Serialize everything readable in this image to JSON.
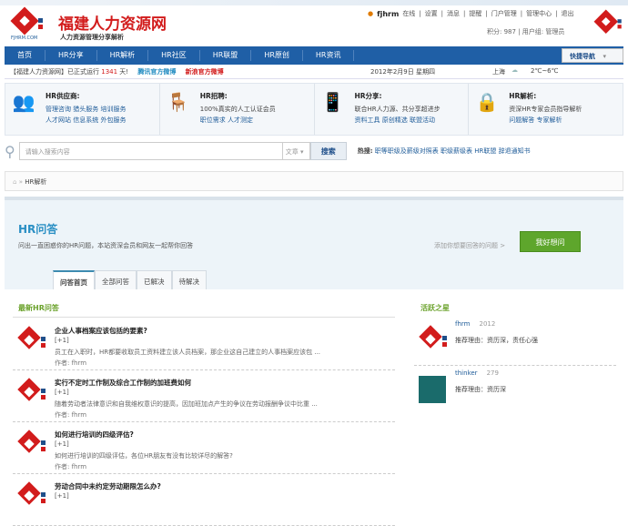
{
  "header": {
    "site_name": "福建人力资源网",
    "slogan": "人力资源管理分享解析",
    "logo_text": "FJHRM.COM",
    "user": "fjhrm",
    "links": [
      "在线",
      "设置",
      "消息",
      "提醒",
      "门户管理",
      "管理中心",
      "退出"
    ],
    "credits": "积分: 987",
    "usergroup": "用户组: 管理员"
  },
  "nav": {
    "items": [
      "首页",
      "HR分享",
      "HR解析",
      "HR社区",
      "HR联盟",
      "HR原创",
      "HR资讯"
    ],
    "quick": "快捷导航"
  },
  "info": {
    "running_prefix": "【福建人力资源网】已正式运行",
    "days": "1341",
    "running_suffix": "天!",
    "tencent": "腾讯官方微博",
    "sina": "新浪官方微博",
    "date": "2012年2月9日 星期四",
    "city": "上海",
    "temp": "2℃~6℃"
  },
  "features": [
    {
      "title": "HR供应商:",
      "line1": "管理咨询 猎头服务 培训服务",
      "line2": "人才网站 信息系统 外包服务"
    },
    {
      "title": "HR招聘:",
      "line1": "100%真实的人工认证会员",
      "line2": "职位需求 人才测定"
    },
    {
      "title": "HR分享:",
      "line1": "联合HR人力源、共分享超进步",
      "line2": "资料工具 原创精选 联盟活动"
    },
    {
      "title": "HR解析:",
      "line1": "资深HR专家会员指导解析",
      "line2": "问题解答 专家解析"
    }
  ],
  "search": {
    "placeholder": "请输入搜索内容",
    "type": "文章",
    "button": "搜索",
    "hot_label": "热搜:",
    "hot": [
      "职等职级及薪级对照表",
      "职级薪级表",
      "HR联盟",
      "辞退通知书"
    ]
  },
  "breadcrumb": {
    "current": "HR解析"
  },
  "qa": {
    "title": "HR问答",
    "desc": "问出一直困惑你的HR问题，本站资深会员和网友一起帮你回答",
    "add": "添加你想要回答的问题 >",
    "ask": "我好想问",
    "tabs": [
      "问答首页",
      "全部问答",
      "已解决",
      "待解决"
    ]
  },
  "latest": {
    "title": "最新HR问答",
    "items": [
      {
        "title": "企业人事档案应该包括的要素?",
        "votes": "[+1]",
        "excerpt": "员工在入职时，HR都要收取员工资料建立该人员档案，那企业这自己建立的人事档案应该包 ...",
        "author": "作者: fhrm"
      },
      {
        "title": "实行不定时工作制及综合工作制的加班费如何",
        "votes": "[+1]",
        "excerpt": "随着劳动者法律意识和自我维权意识的提高，因加班加点产生的争议在劳动报酬争议中比重 ...",
        "author": "作者: fhrm"
      },
      {
        "title": "如何进行培训的四级评估?",
        "votes": "[+1]",
        "excerpt": "如何进行培训的四级评估，各位HR朋友有没有比较详尽的解答?",
        "author": "作者: fhrm"
      },
      {
        "title": "劳动合同中未约定劳动期限怎么办?",
        "votes": "[+1]",
        "excerpt": "",
        "author": ""
      }
    ]
  },
  "active": {
    "title": "活跃之星",
    "members": [
      {
        "name": "fhrm",
        "count": "2012",
        "reason": "推荐理由：资历深，责任心强"
      },
      {
        "name": "thinker",
        "count": "279",
        "reason": "推荐理由：资历深"
      }
    ]
  }
}
